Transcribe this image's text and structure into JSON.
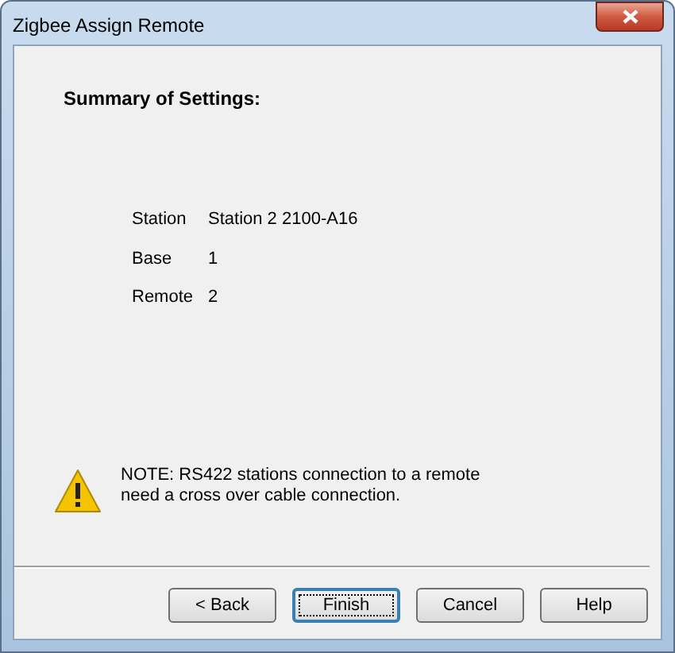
{
  "window": {
    "title": "Zigbee Assign Remote"
  },
  "heading": "Summary of Settings:",
  "settings": [
    {
      "label": "Station",
      "value": "Station 2 2100-A16"
    },
    {
      "label": "Base",
      "value": "1"
    },
    {
      "label": "Remote",
      "value": "2"
    }
  ],
  "note": "NOTE: RS422 stations connection to a remote need a cross over cable connection.",
  "buttons": [
    {
      "label": "< Back",
      "default": false
    },
    {
      "label": "Finish",
      "default": true
    },
    {
      "label": "Cancel",
      "default": false
    },
    {
      "label": "Help",
      "default": false
    }
  ]
}
